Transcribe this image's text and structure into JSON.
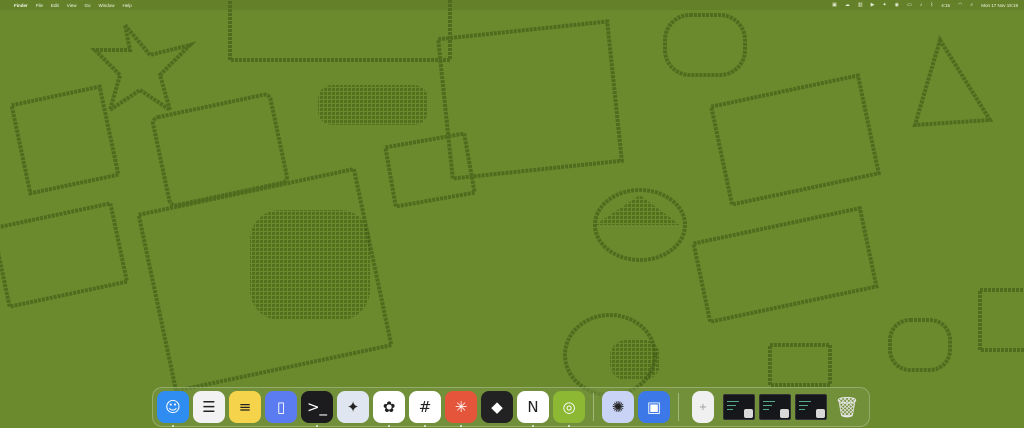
{
  "menubar": {
    "apple_glyph": "",
    "app_name": "Finder",
    "menus": [
      "File",
      "Edit",
      "View",
      "Go",
      "Window",
      "Help"
    ],
    "status_icons": [
      "camera-icon",
      "cloud-icon",
      "bars-icon",
      "play-icon",
      "star-icon",
      "control-icon",
      "battery-icon",
      "volume-icon",
      "bluetooth-icon",
      "wifi-icon",
      "search-icon"
    ],
    "status_time_text": "4:15",
    "date_text": "Mon 17 Nov 19:19"
  },
  "dock": {
    "apps": [
      {
        "name": "finder",
        "glyph": "☺",
        "bg": "#2f8cf0",
        "running": true
      },
      {
        "name": "reminders",
        "glyph": "☰",
        "bg": "#f2f2f2",
        "running": false
      },
      {
        "name": "notes",
        "glyph": "≡",
        "bg": "#f5d34a",
        "running": false
      },
      {
        "name": "simulator",
        "glyph": "▯",
        "bg": "#5a7cf0",
        "running": false
      },
      {
        "name": "terminal",
        "glyph": ">_",
        "bg": "#1c1c1e",
        "running": true
      },
      {
        "name": "xcode",
        "glyph": "✦",
        "bg": "#dfe6f0",
        "running": false
      },
      {
        "name": "chatgpt",
        "glyph": "✿",
        "bg": "#ffffff",
        "running": true
      },
      {
        "name": "slack",
        "glyph": "#",
        "bg": "#ffffff",
        "running": true
      },
      {
        "name": "claude",
        "glyph": "✳",
        "bg": "#e5553b",
        "running": true
      },
      {
        "name": "blender",
        "glyph": "◆",
        "bg": "#222222",
        "running": false
      },
      {
        "name": "notion",
        "glyph": "N",
        "bg": "#ffffff",
        "running": true
      },
      {
        "name": "spiral-app",
        "glyph": "◎",
        "bg": "#8cb833",
        "running": true
      }
    ],
    "apps2": [
      {
        "name": "perplexity",
        "glyph": "✺",
        "bg": "#c8d3f5",
        "running": false
      },
      {
        "name": "inbox",
        "glyph": "▣",
        "bg": "#3d78e8",
        "running": false
      }
    ],
    "minimized": [
      {
        "name": "downloads-stack",
        "kind": "doc"
      },
      {
        "name": "minimized-window-1",
        "kind": "thumb"
      },
      {
        "name": "minimized-window-2",
        "kind": "thumb"
      },
      {
        "name": "minimized-window-3",
        "kind": "thumb"
      },
      {
        "name": "trash",
        "kind": "trash"
      }
    ]
  }
}
